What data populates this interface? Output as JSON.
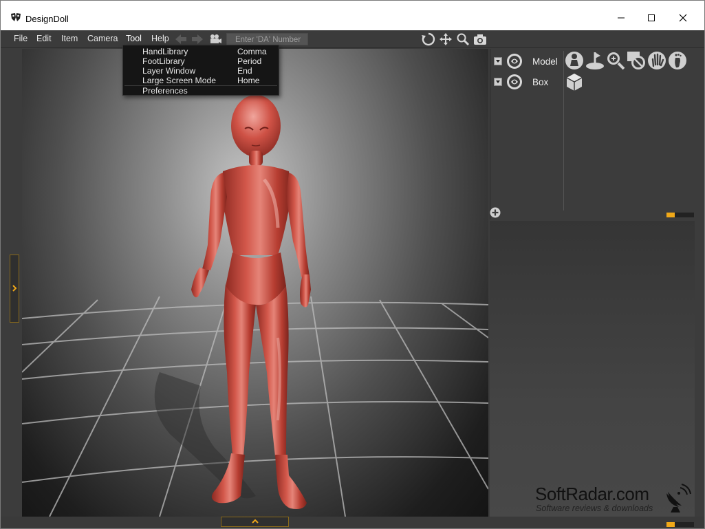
{
  "window": {
    "title": "DesignDoll"
  },
  "titlebar": {
    "minimize": "—",
    "maximize": "☐",
    "close": "✕"
  },
  "menubar": {
    "items": [
      {
        "label": "File"
      },
      {
        "label": "Edit"
      },
      {
        "label": "Item"
      },
      {
        "label": "Camera"
      },
      {
        "label": "Tool"
      },
      {
        "label": "Help"
      }
    ],
    "da_placeholder": "Enter 'DA' Number"
  },
  "tool_menu": {
    "items": [
      {
        "label": "HandLibrary",
        "shortcut": "Comma"
      },
      {
        "label": "FootLibrary",
        "shortcut": "Period"
      },
      {
        "label": "Layer Window",
        "shortcut": "End"
      },
      {
        "label": "Large Screen Mode",
        "shortcut": "Home"
      },
      {
        "label": "Preferences",
        "shortcut": ""
      }
    ]
  },
  "layers": [
    {
      "name": "Model"
    },
    {
      "name": "Box"
    }
  ],
  "watermark": {
    "title": "SoftRadar.com",
    "subtitle": "Software reviews & downloads"
  },
  "colors": {
    "accent": "#f0a818",
    "doll": "#c8473c",
    "panel": "#3c3c3c"
  }
}
